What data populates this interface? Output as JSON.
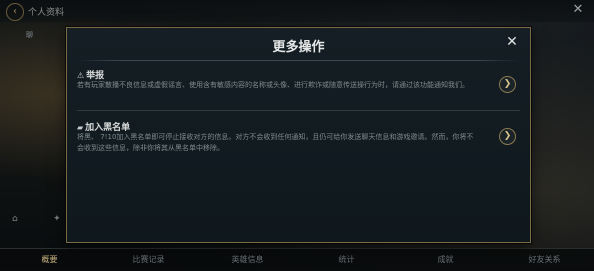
{
  "background": {
    "page_title": "个人资料",
    "side_label": "聊",
    "bottom_tabs": [
      "概要",
      "比赛记录",
      "英雄信息",
      "统计",
      "成就",
      "好友关系"
    ],
    "active_tab_index": 0
  },
  "modal": {
    "title": "更多操作",
    "close_symbol": "✕",
    "options": [
      {
        "icon": "⚠",
        "label": "举报",
        "description": "若有玩家散播不良信息或虚假谣言、使用含有敏感内容的名称或头像、进行欺诈或随意传送操行为时，请通过该功能通知我们。"
      },
      {
        "icon": "▰",
        "label": "加入黑名单",
        "description": "将黑、 7!10加入黑名单即可停止接收对方的信息。对方不会收到任何通知，且仍可给你发送聊天信息和游戏邀请。然而，你将不会收到这些信息，除非你将其从黑名单中移除。"
      }
    ],
    "arrow_symbol": "❯"
  },
  "colors": {
    "accent_gold": "#c9b37e",
    "modal_border": "#7a6a45",
    "modal_bg": "#141e24"
  }
}
